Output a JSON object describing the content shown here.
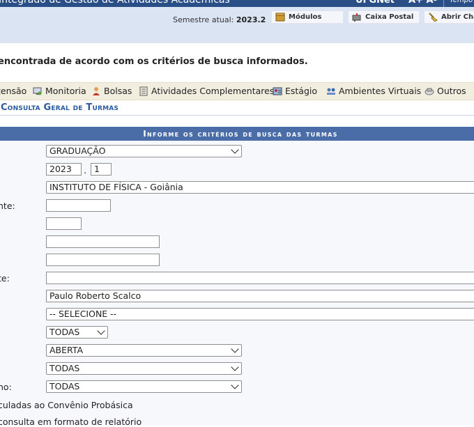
{
  "header": {
    "title": "Integrado de Gestão de Atividades Acadêmicas",
    "ufgnet": "UFGNet",
    "font_controls": "A+ A-",
    "tempo": "Tempo"
  },
  "infobar": {
    "semestre_label": "Semestre atual:",
    "semestre_value": "2023.2",
    "buttons": [
      "Módulos",
      "Caixa Postal",
      "Abrir Cha"
    ]
  },
  "message": "encontrada de acordo com os critérios de busca informados.",
  "menu": [
    "tensão",
    "Monitoria",
    "Bolsas",
    "Atividades Complementares",
    "Estágio",
    "Ambientes Virtuais",
    "Outros"
  ],
  "page_title": "Consulta Geral de Turmas",
  "form": {
    "heading": "Informe os critérios de busca das turmas",
    "nivel": "GRADUAÇÃO",
    "ano": "2023",
    "periodo": "1",
    "unidade": "INSTITUTO DE FÍSICA - Goiânia",
    "docente": "Paulo Roberto Scalco",
    "selecione": "-- SELECIONE --",
    "todas_small": "TODAS",
    "situacao": "ABERTA",
    "todas_1": "TODAS",
    "todas_2": "TODAS",
    "labels": {
      "nte": "nte:",
      "te": "te:",
      "no": "no:",
      "probasica": "culadas ao Convênio Probásica",
      "relatorio": "consulta em formato de relatório"
    },
    "dot": "."
  }
}
